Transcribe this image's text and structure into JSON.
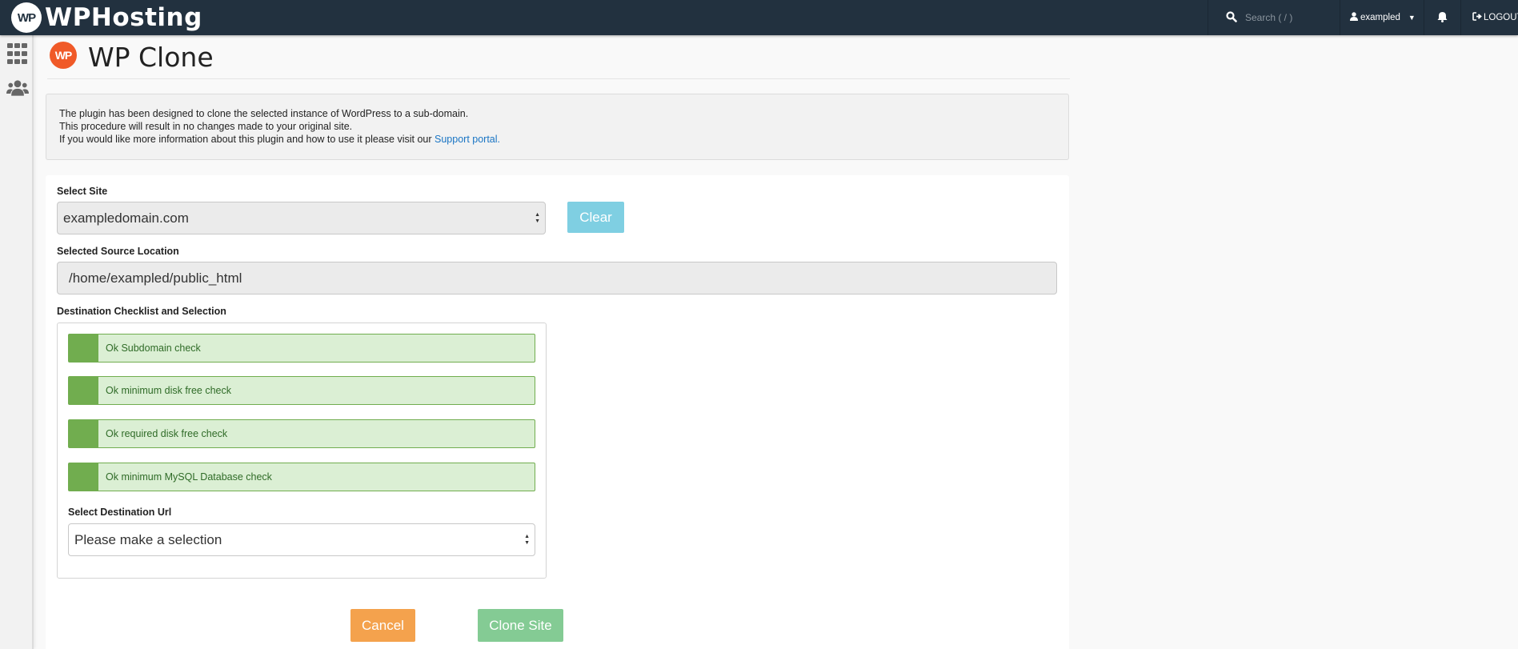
{
  "topbar": {
    "brand_logo": "WP",
    "brand_name": "WPHosting",
    "search_placeholder": "Search ( / )",
    "username": "exampled",
    "logout_label": "LOGOUT",
    "icons": {
      "search": "search-icon",
      "user": "user-icon",
      "caret": "caret-down-icon",
      "bell": "bell-icon",
      "logout": "sign-out-icon"
    }
  },
  "sidebar": {
    "items": [
      {
        "name": "apps",
        "icon": "grid-icon"
      },
      {
        "name": "users",
        "icon": "users-icon"
      }
    ]
  },
  "page": {
    "logo_text": "WP",
    "title": "WP Clone"
  },
  "info": {
    "line1": "The plugin has been designed to clone the selected instance of WordPress to a sub-domain.",
    "line2": "This procedure will result in no changes made to your original site.",
    "line3_prefix": "If you would like more information about this plugin and how to use it please visit our ",
    "link_label": "Support portal."
  },
  "form": {
    "select_site_label": "Select Site",
    "select_site_value": "exampledomain.com",
    "clear_label": "Clear",
    "source_label": "Selected Source Location",
    "source_value": "/home/exampled/public_html",
    "destination_label": "Destination Checklist and Selection",
    "checks": [
      {
        "label": "Ok Subdomain check",
        "status": "ok"
      },
      {
        "label": "Ok minimum disk free check",
        "status": "ok"
      },
      {
        "label": "Ok required disk free check",
        "status": "ok"
      },
      {
        "label": "Ok minimum MySQL Database check",
        "status": "ok"
      }
    ],
    "dest_url_label": "Select Destination Url",
    "dest_url_value": "Please make a selection",
    "cancel_label": "Cancel",
    "clone_label": "Clone Site"
  },
  "colors": {
    "topbar": "#22313f",
    "brand_orange": "#f05a28",
    "clear_button": "#7fcfe2",
    "cancel_button": "#f4a24d",
    "clone_button": "#84cb94",
    "check_ok_bar": "#71ad4f",
    "check_ok_bg": "#dbefd4",
    "link": "#1a75c4"
  }
}
